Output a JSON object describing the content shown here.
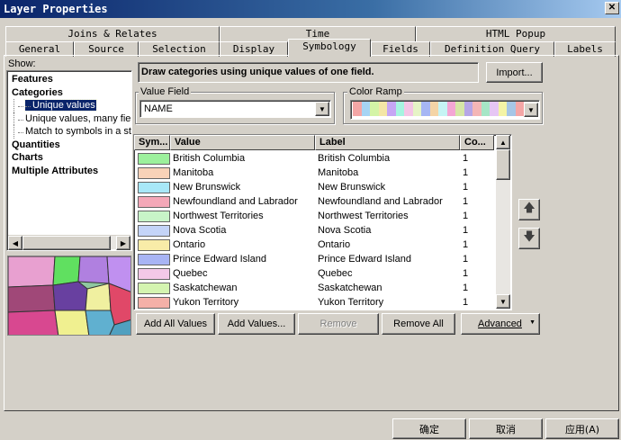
{
  "window": {
    "title": "Layer Properties",
    "close_glyph": "✕"
  },
  "tabs_row1": [
    {
      "label": "Joins & Relates"
    },
    {
      "label": "Time"
    },
    {
      "label": "HTML Popup"
    }
  ],
  "tabs_row2": [
    {
      "label": "General"
    },
    {
      "label": "Source"
    },
    {
      "label": "Selection"
    },
    {
      "label": "Display"
    },
    {
      "label": "Symbology",
      "active": true
    },
    {
      "label": "Fields"
    },
    {
      "label": "Definition Query"
    },
    {
      "label": "Labels"
    }
  ],
  "show": {
    "label": "Show:",
    "items": [
      {
        "label": "Features",
        "bold": true
      },
      {
        "label": "Categories",
        "bold": true
      },
      {
        "label": "Unique values",
        "selected": true
      },
      {
        "label": "Unique values, many fiel"
      },
      {
        "label": "Match to symbols in a sty"
      },
      {
        "label": "Quantities",
        "bold": true
      },
      {
        "label": "Charts",
        "bold": true
      },
      {
        "label": "Multiple Attributes",
        "bold": true
      }
    ]
  },
  "description": "Draw categories using unique values of one field.",
  "import_button": "Import...",
  "value_field": {
    "label": "Value Field",
    "value": "NAME"
  },
  "color_ramp": {
    "label": "Color Ramp",
    "colors": [
      "#f4a6a6",
      "#a6d4f4",
      "#d4f4a6",
      "#f4e6a6",
      "#c6a6f4",
      "#a6f4e0",
      "#f4c6e6",
      "#e6f4c6",
      "#a6b6f4",
      "#f4d4a6",
      "#c6f4f4",
      "#f4a6d4",
      "#d6e6a6",
      "#b6a6e6",
      "#f4b6b6",
      "#a6e6c6",
      "#e6c6f4",
      "#f4f4a6",
      "#a6c6e6",
      "#f4a6a6"
    ]
  },
  "table": {
    "headers": {
      "symbol": "Sym...",
      "value": "Value",
      "label": "Label",
      "count": "Co..."
    },
    "rows": [
      {
        "value": "British Columbia",
        "label": "British Columbia",
        "count": "1",
        "color": "#9cf09c"
      },
      {
        "value": "Manitoba",
        "label": "Manitoba",
        "count": "1",
        "color": "#f8d2b8"
      },
      {
        "value": "New Brunswick",
        "label": "New Brunswick",
        "count": "1",
        "color": "#a8e8f8"
      },
      {
        "value": "Newfoundland and Labrador",
        "label": "Newfoundland and Labrador",
        "count": "1",
        "color": "#f4a8b8"
      },
      {
        "value": "Northwest Territories",
        "label": "Northwest Territories",
        "count": "1",
        "color": "#c8f4c8"
      },
      {
        "value": "Nova Scotia",
        "label": "Nova Scotia",
        "count": "1",
        "color": "#c4d4f8"
      },
      {
        "value": "Ontario",
        "label": "Ontario",
        "count": "1",
        "color": "#f8eca8"
      },
      {
        "value": "Prince Edward Island",
        "label": "Prince Edward Island",
        "count": "1",
        "color": "#a8b4f4"
      },
      {
        "value": "Quebec",
        "label": "Quebec",
        "count": "1",
        "color": "#f4c8e8"
      },
      {
        "value": "Saskatchewan",
        "label": "Saskatchewan",
        "count": "1",
        "color": "#d4f4b0"
      },
      {
        "value": "Yukon Territory",
        "label": "Yukon Territory",
        "count": "1",
        "color": "#f4b0a8"
      }
    ]
  },
  "buttons": {
    "add_all": "Add All Values",
    "add_values": "Add Values...",
    "remove": "Remove",
    "remove_all": "Remove All",
    "advanced": "Advanced"
  },
  "footer": {
    "ok": "确定",
    "cancel": "取消",
    "apply": "应用(A)"
  }
}
